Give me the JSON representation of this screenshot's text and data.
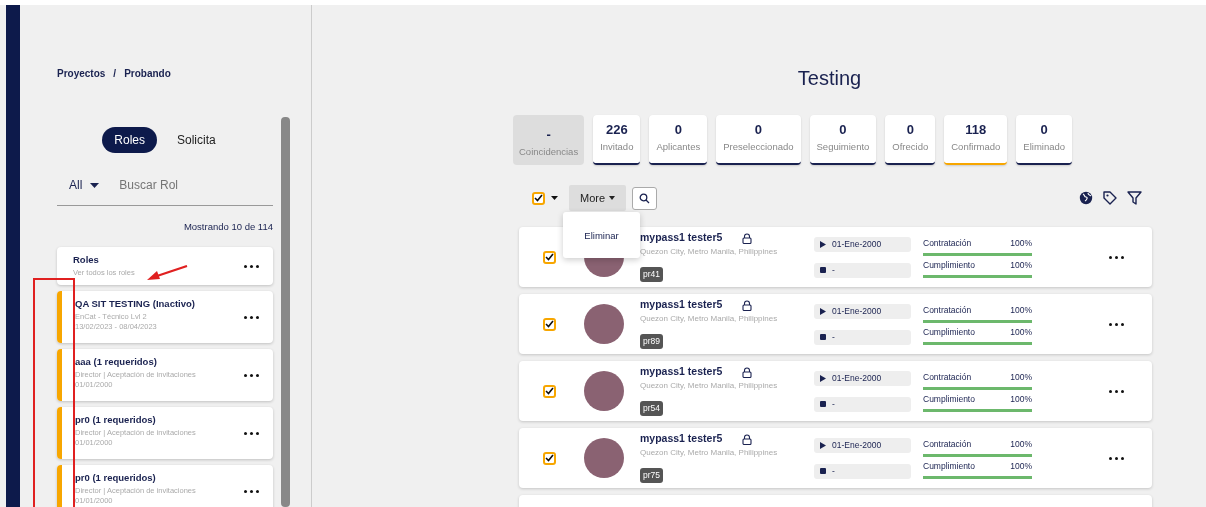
{
  "breadcrumb": [
    {
      "label": "Proyectos"
    },
    {
      "label": "Probando"
    }
  ],
  "breadcrumb_separator": "/",
  "panel_tabs": [
    {
      "label": "Roles",
      "selected": true
    },
    {
      "label": "Solicita",
      "selected": false
    }
  ],
  "filter": {
    "value": "All",
    "placeholder": "Buscar Rol"
  },
  "showing": "Mostrando 10 de 114",
  "roles": [
    {
      "kind": "all",
      "title": "Roles",
      "lines": [
        "Ver todos los roles"
      ]
    },
    {
      "kind": "role",
      "title": "QA SIT TESTING (Inactivo)",
      "lines": [
        "EnCat - Técnico Lvl 2",
        "13/02/2023 - 08/04/2023"
      ]
    },
    {
      "kind": "role",
      "title": "aaa (1 requeridos)",
      "lines": [
        "Director | Aceptación de invitaciones",
        "01/01/2000"
      ]
    },
    {
      "kind": "role",
      "title": "pr0 (1 requeridos)",
      "lines": [
        "Director | Aceptación de invitaciones",
        "01/01/2000"
      ]
    },
    {
      "kind": "role",
      "title": "pr0 (1 requeridos)",
      "lines": [
        "Director | Aceptación de invitaciones",
        "01/01/2000"
      ]
    }
  ],
  "title": "Testing",
  "stats": [
    {
      "kind": "matches",
      "count": "-",
      "label": "Coincidencias",
      "selected": false
    },
    {
      "kind": "stage",
      "count": "226",
      "label": "Invitado",
      "selected": false
    },
    {
      "kind": "stage",
      "count": "0",
      "label": "Aplicantes",
      "selected": false
    },
    {
      "kind": "stage",
      "count": "0",
      "label": "Preseleccionado",
      "selected": false
    },
    {
      "kind": "stage",
      "count": "0",
      "label": "Seguimiento",
      "selected": false
    },
    {
      "kind": "stage",
      "count": "0",
      "label": "Ofrecido",
      "selected": false
    },
    {
      "kind": "stage",
      "count": "118",
      "label": "Confirmado",
      "selected": true
    },
    {
      "kind": "stage",
      "count": "0",
      "label": "Eliminado",
      "selected": false
    }
  ],
  "toolbar": {
    "select_all_checked": true,
    "more_button": "More",
    "menu_items": [
      "Eliminar"
    ]
  },
  "candidates": [
    {
      "checked": true,
      "name": "mypass1 tester5",
      "location": "Quezon City, Metro Manila, Philippines",
      "tag": "pr41",
      "start": "01-Ene-2000",
      "end": "-",
      "metrics": [
        {
          "label": "Contratación",
          "value": "100%",
          "level": 1
        },
        {
          "label": "Cumplimiento",
          "value": "100%",
          "level": 1
        }
      ]
    },
    {
      "checked": true,
      "name": "mypass1 tester5",
      "location": "Quezon City, Metro Manila, Philippines",
      "tag": "pr89",
      "start": "01-Ene-2000",
      "end": "-",
      "metrics": [
        {
          "label": "Contratación",
          "value": "100%",
          "level": 1
        },
        {
          "label": "Cumplimiento",
          "value": "100%",
          "level": 1
        }
      ]
    },
    {
      "checked": true,
      "name": "mypass1 tester5",
      "location": "Quezon City, Metro Manila, Philippines",
      "tag": "pr54",
      "start": "01-Ene-2000",
      "end": "-",
      "metrics": [
        {
          "label": "Contratación",
          "value": "100%",
          "level": 1
        },
        {
          "label": "Cumplimiento",
          "value": "100%",
          "level": 1
        }
      ]
    },
    {
      "checked": true,
      "name": "mypass1 tester5",
      "location": "Quezon City, Metro Manila, Philippines",
      "tag": "pr75",
      "start": "01-Ene-2000",
      "end": "-",
      "metrics": [
        {
          "label": "Contratación",
          "value": "100%",
          "level": 1
        },
        {
          "label": "Cumplimiento",
          "value": "100%",
          "level": 1
        }
      ]
    }
  ]
}
